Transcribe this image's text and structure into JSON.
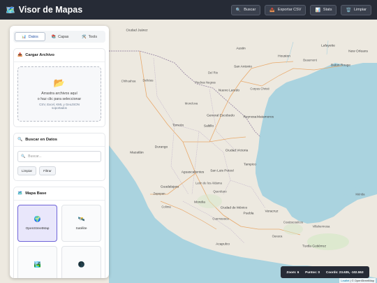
{
  "header": {
    "title": "Visor de Mapas",
    "title_icon": "map-icon",
    "buttons": [
      {
        "label": "Buscar",
        "icon": "search-icon"
      },
      {
        "label": "Exportar CSV",
        "icon": "export-icon"
      },
      {
        "label": "Stats",
        "icon": "stats-icon"
      },
      {
        "label": "Limpiar",
        "icon": "trash-icon"
      }
    ]
  },
  "sidebar": {
    "tabs": [
      {
        "label": "Datos",
        "icon": "chart-icon",
        "active": true
      },
      {
        "label": "Capas",
        "icon": "layers-icon",
        "active": false
      },
      {
        "label": "Tools",
        "icon": "tools-icon",
        "active": false
      }
    ],
    "upload": {
      "title": "Cargar Archivo",
      "line1": "Arrastra archivos aquí",
      "line2": "o haz clic para seleccionar",
      "formats": "CSV, Excel, KML y GeoJSON soportados"
    },
    "search": {
      "title": "Buscar en Datos",
      "placeholder": "Buscar...",
      "clear_label": "Limpiar",
      "filter_label": "Filtrar"
    },
    "basemap": {
      "title": "Mapa Base",
      "options": [
        {
          "label": "OpenStreetMap",
          "icon": "globe-icon",
          "active": true
        },
        {
          "label": "Satélite",
          "icon": "satellite-icon",
          "active": false
        },
        {
          "label": "",
          "icon": "terrain-icon",
          "active": false
        },
        {
          "label": "",
          "icon": "dark-icon",
          "active": false
        }
      ]
    }
  },
  "map": {
    "labels": [
      {
        "text": "Ciudad Juárez"
      },
      {
        "text": "Austin"
      },
      {
        "text": "Houston"
      },
      {
        "text": "San Antonio"
      },
      {
        "text": "Lafayette"
      },
      {
        "text": "New Orleans"
      },
      {
        "text": "Baton Rouge"
      },
      {
        "text": "Beaumont"
      },
      {
        "text": "Del Rio"
      },
      {
        "text": "Piedras Negras"
      },
      {
        "text": "Nuevo Laredo"
      },
      {
        "text": "Corpus Christi"
      },
      {
        "text": "Chihuahua"
      },
      {
        "text": "Delicias"
      },
      {
        "text": "Monclova"
      },
      {
        "text": "General Escobedo"
      },
      {
        "text": "Reynosa"
      },
      {
        "text": "Matamoros"
      },
      {
        "text": "Torreón"
      },
      {
        "text": "Saltillo"
      },
      {
        "text": "Mazatlán"
      },
      {
        "text": "Durango"
      },
      {
        "text": "Ciudad Victoria"
      },
      {
        "text": "Aguascalientes"
      },
      {
        "text": "San Luis Potosí"
      },
      {
        "text": "Tampico"
      },
      {
        "text": "Guadalajara"
      },
      {
        "text": "León de los Aldama"
      },
      {
        "text": "Morelia"
      },
      {
        "text": "Ciudad de México"
      },
      {
        "text": "Puebla"
      },
      {
        "text": "Cuernavaca"
      },
      {
        "text": "Veracruz"
      },
      {
        "text": "Coatzacoalcos"
      },
      {
        "text": "Villahermosa"
      },
      {
        "text": "Acapulco"
      },
      {
        "text": "Oaxaca"
      },
      {
        "text": "Tuxtla Gutiérrez"
      },
      {
        "text": "Mérida"
      },
      {
        "text": "Colima"
      },
      {
        "text": "Zapopan"
      },
      {
        "text": "Querétaro"
      }
    ]
  },
  "status": {
    "zoom": "Zoom: 6",
    "points": "Puntos: 0",
    "coords": "Coords: 23.635, -102.553"
  },
  "attribution": {
    "leaflet": "Leaflet",
    "osm": "| © OpenStreetMap"
  },
  "colors": {
    "header_bg": "#262b36",
    "land": "#ede9e0",
    "sea": "#aad3df",
    "active_tab_text": "#2553a8",
    "active_basemap_border": "#6e63d8"
  }
}
